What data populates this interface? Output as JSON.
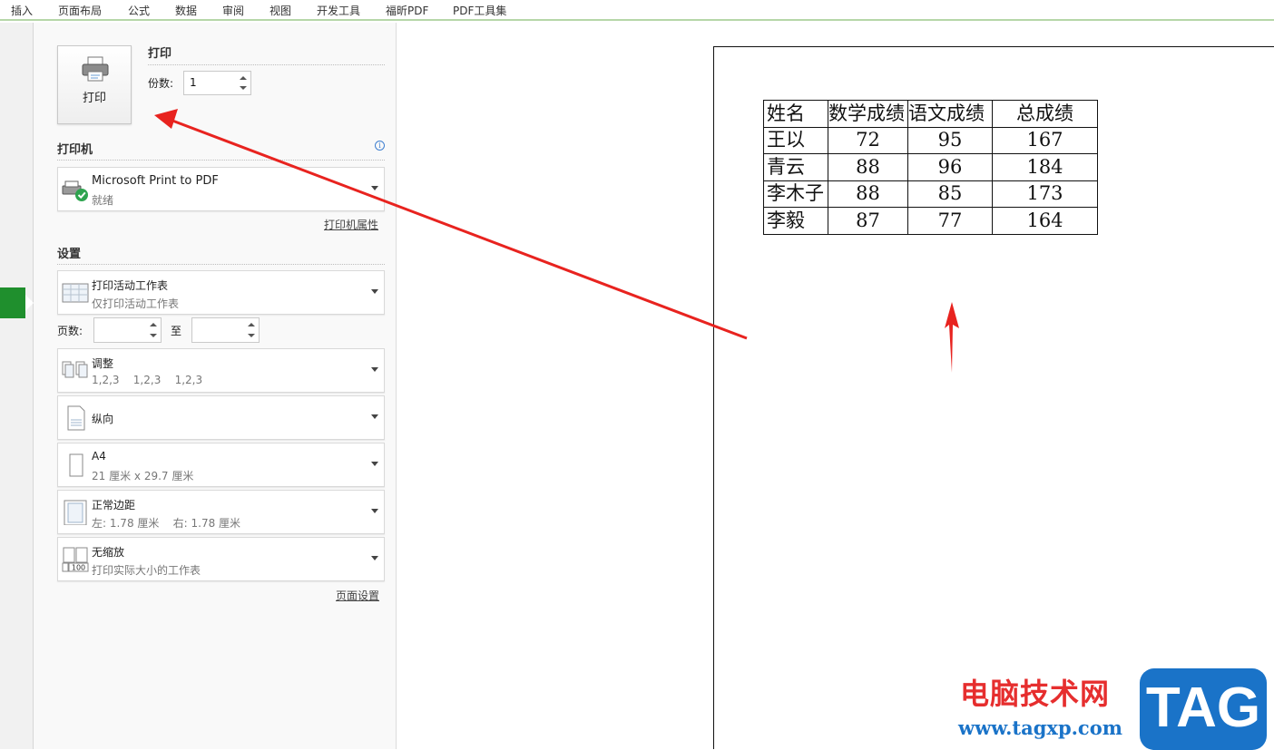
{
  "ribbon": {
    "tabs": [
      "插入",
      "页面布局",
      "公式",
      "数据",
      "审阅",
      "视图",
      "开发工具",
      "福昕PDF",
      "PDF工具集"
    ]
  },
  "print": {
    "section_title": "打印",
    "button_label": "打印",
    "copies_label": "份数:",
    "copies_value": "1"
  },
  "printer": {
    "section_title": "打印机",
    "name": "Microsoft Print to PDF",
    "status": "就绪",
    "properties_link": "打印机属性"
  },
  "settings": {
    "section_title": "设置",
    "scope": {
      "title": "打印活动工作表",
      "sub": "仅打印活动工作表"
    },
    "pages_label": "页数:",
    "pages_to_label": "至",
    "collate": {
      "title": "调整",
      "sub": "1,2,3    1,2,3    1,2,3"
    },
    "orientation": {
      "title": "纵向"
    },
    "paper": {
      "title": "A4",
      "sub": "21 厘米 x 29.7 厘米"
    },
    "margins": {
      "title": "正常边距",
      "sub": "左: 1.78 厘米    右: 1.78 厘米"
    },
    "scaling": {
      "title": "无缩放",
      "sub": "打印实际大小的工作表"
    },
    "scaling_icon_text": "100",
    "page_setup_link": "页面设置"
  },
  "sheet": {
    "headers": [
      "姓名",
      "数学成绩",
      "语文成绩",
      "总成绩"
    ],
    "rows": [
      [
        "王以",
        "72",
        "95",
        "167"
      ],
      [
        "青云",
        "88",
        "96",
        "184"
      ],
      [
        "李木子",
        "88",
        "85",
        "173"
      ],
      [
        "李毅",
        "87",
        "77",
        "164"
      ]
    ]
  },
  "watermark": {
    "title": "电脑技术网",
    "url": "www.tagxp.com",
    "logo": "TAG"
  },
  "colors": {
    "accent_green": "#1f8f2d",
    "arrow_red": "#e8231f",
    "watermark_red": "#e62e2e",
    "watermark_blue": "#1a73c8"
  }
}
